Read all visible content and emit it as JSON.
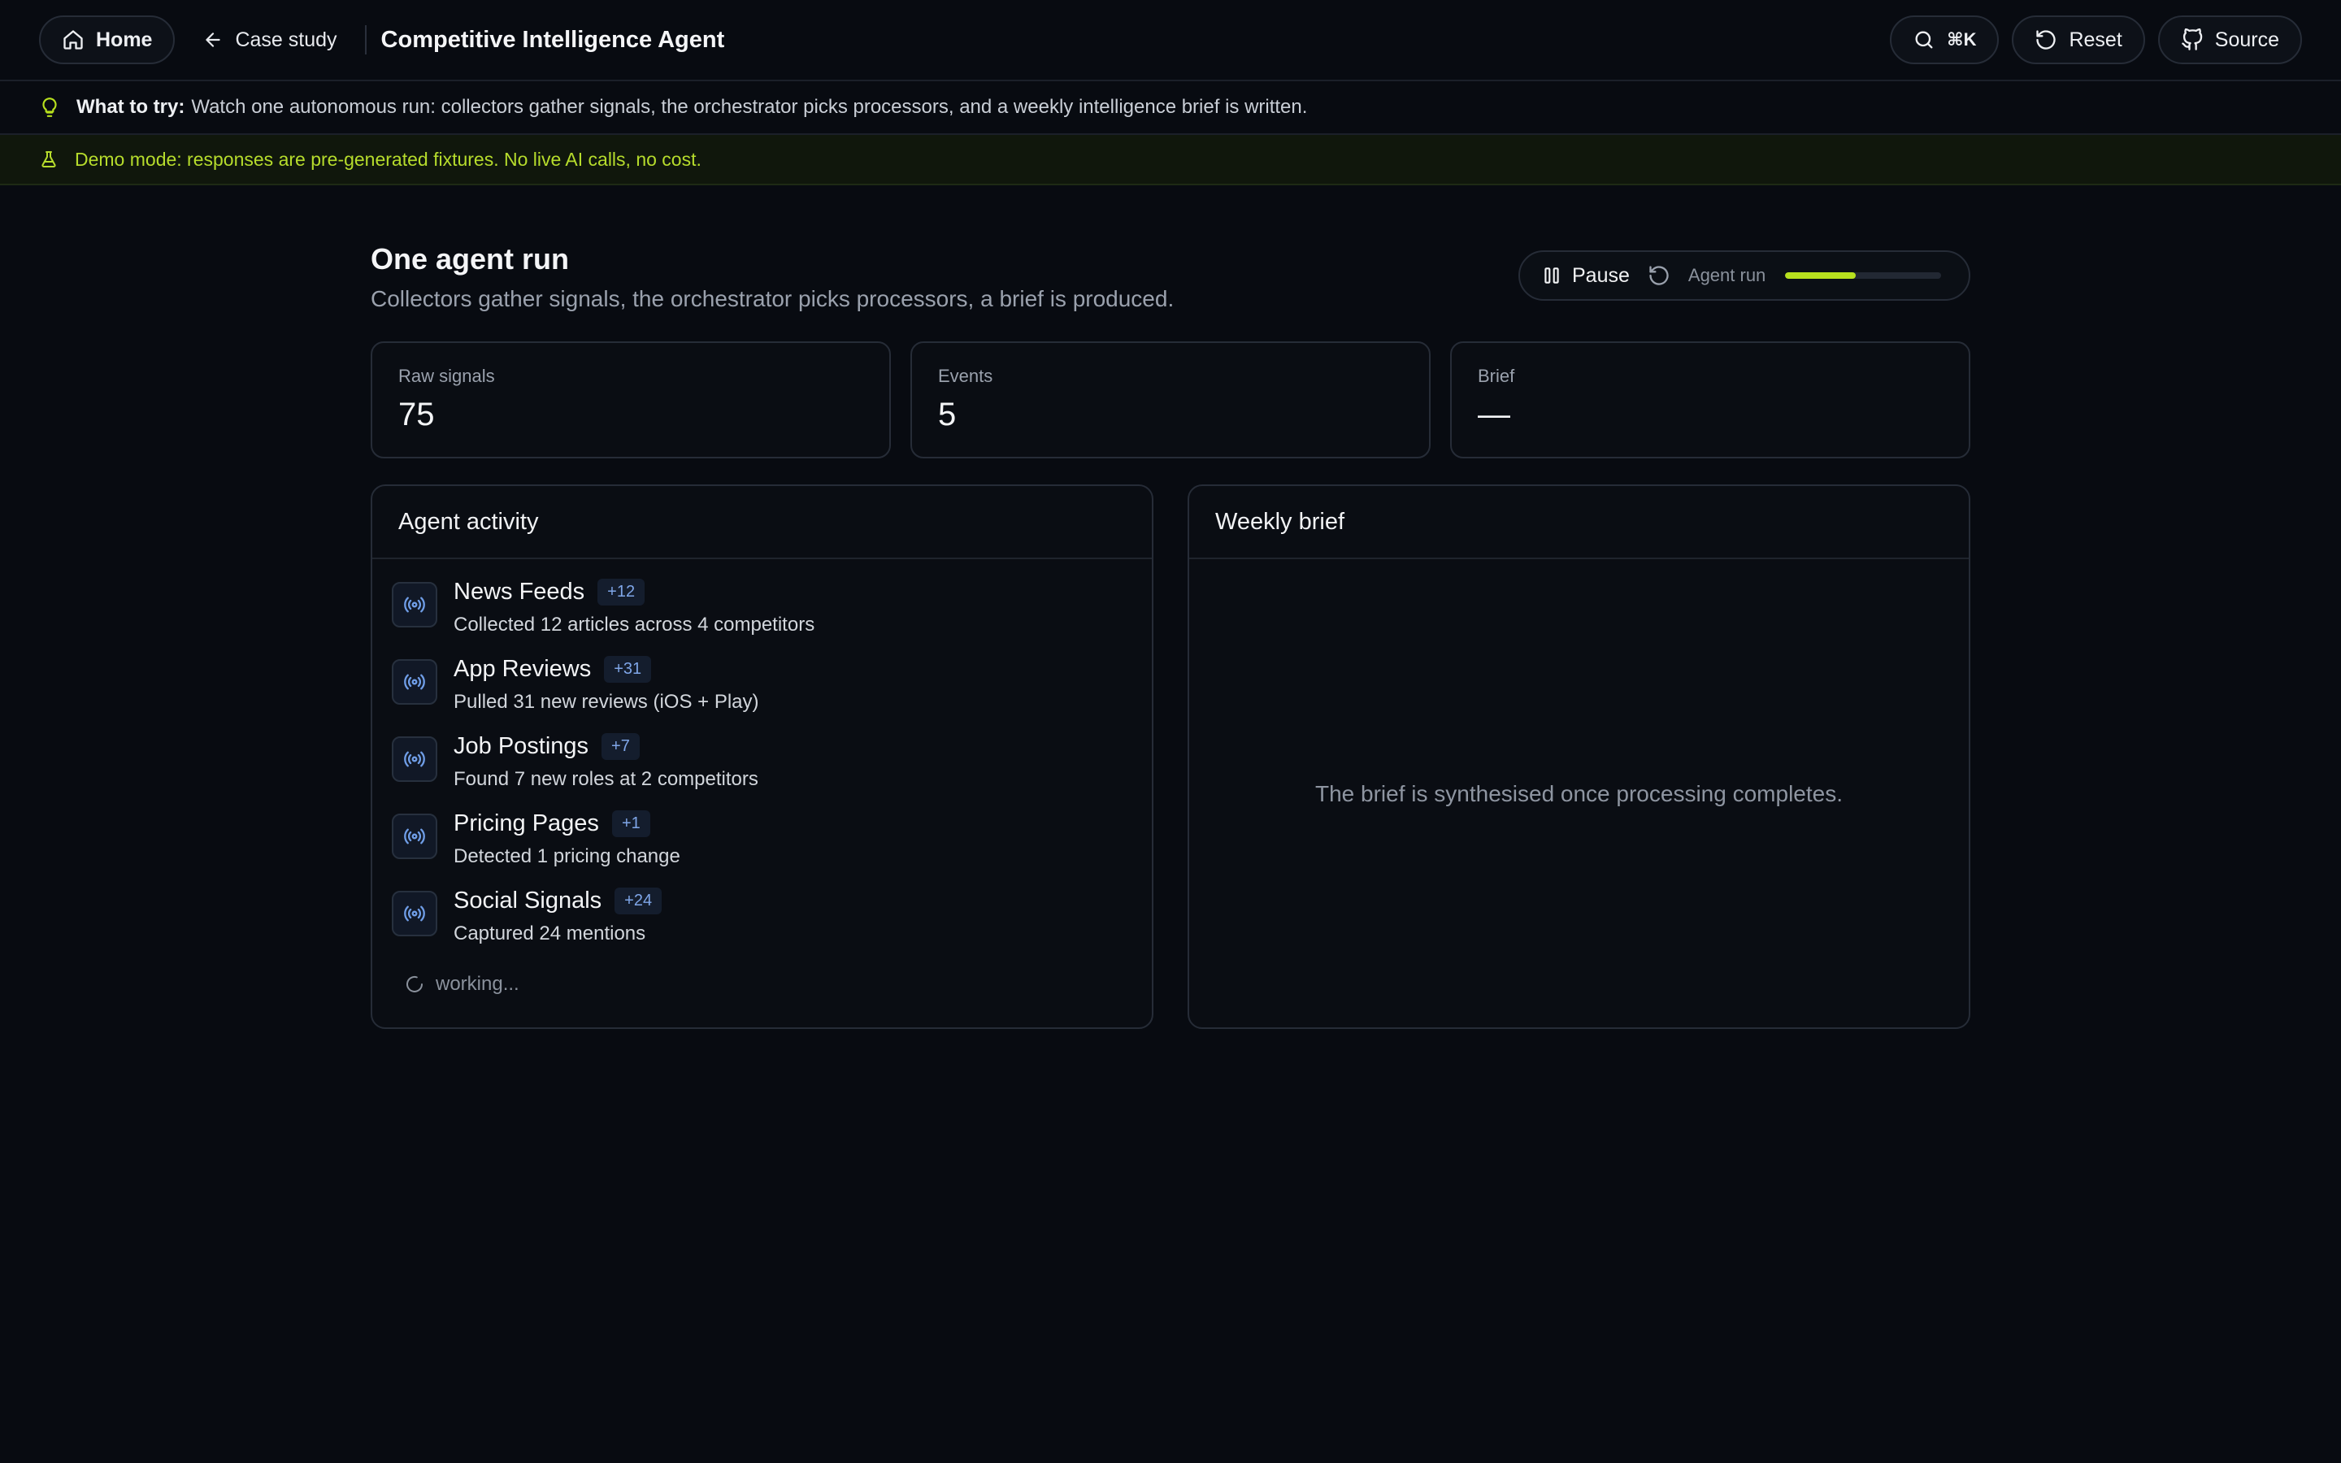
{
  "header": {
    "home_label": "Home",
    "back_label": "Case study",
    "app_title": "Competitive Intelligence Agent",
    "search_shortcut": "⌘K",
    "reset_label": "Reset",
    "source_label": "Source"
  },
  "tip": {
    "label": "What to try:",
    "text": "Watch one autonomous run: collectors gather signals, the orchestrator picks processors, and a weekly intelligence brief is written."
  },
  "demo": {
    "text": "Demo mode: responses are pre-generated fixtures. No live AI calls, no cost."
  },
  "run": {
    "title": "One agent run",
    "subtitle": "Collectors gather signals, the orchestrator picks processors, a brief is produced.",
    "pause_label": "Pause",
    "run_label": "Agent run",
    "progress": 0.45
  },
  "stats": [
    {
      "label": "Raw signals",
      "value": "75"
    },
    {
      "label": "Events",
      "value": "5"
    },
    {
      "label": "Brief",
      "value": "—"
    }
  ],
  "activity": {
    "title": "Agent activity",
    "items": [
      {
        "title": "News Feeds",
        "badge": "+12",
        "desc": "Collected 12 articles across 4 competitors"
      },
      {
        "title": "App Reviews",
        "badge": "+31",
        "desc": "Pulled 31 new reviews (iOS + Play)"
      },
      {
        "title": "Job Postings",
        "badge": "+7",
        "desc": "Found 7 new roles at 2 competitors"
      },
      {
        "title": "Pricing Pages",
        "badge": "+1",
        "desc": "Detected 1 pricing change"
      },
      {
        "title": "Social Signals",
        "badge": "+24",
        "desc": "Captured 24 mentions"
      }
    ],
    "working_label": "working..."
  },
  "brief": {
    "title": "Weekly brief",
    "placeholder": "The brief is synthesised once processing completes."
  },
  "colors": {
    "background": "#080b11",
    "accent": "#b7e01e",
    "badge_text": "#7fa6e8"
  }
}
